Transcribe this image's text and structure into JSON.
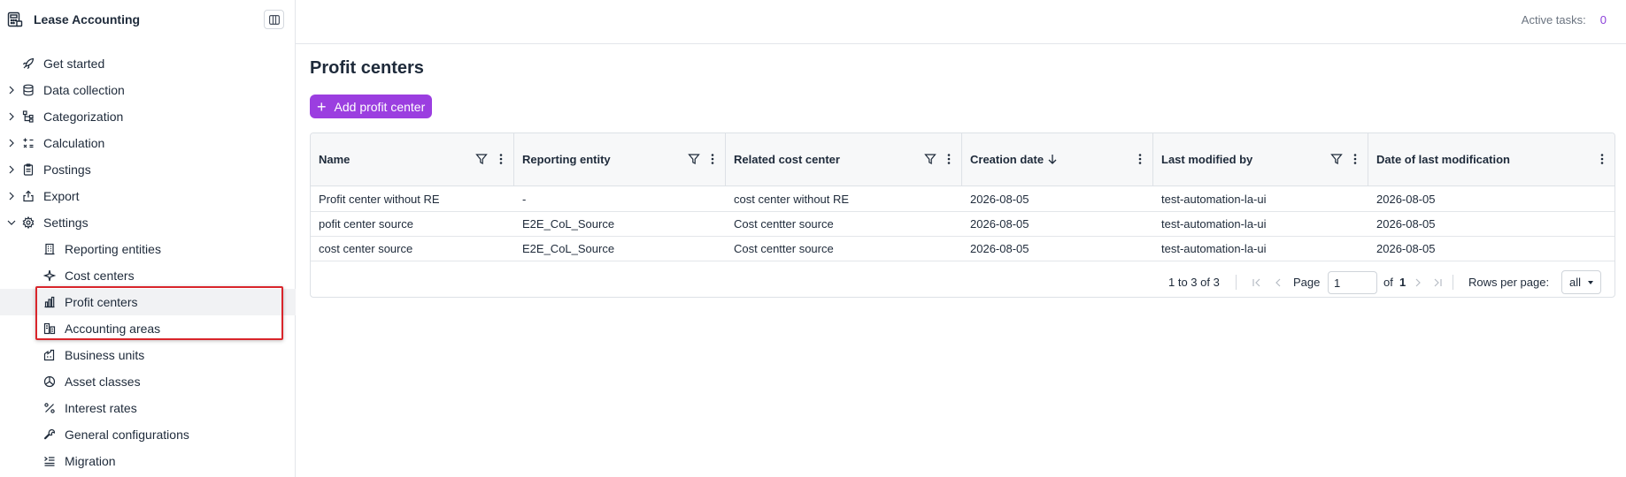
{
  "app": {
    "title": "Lease Accounting"
  },
  "sidebar": {
    "items": [
      {
        "label": "Get started",
        "icon": "rocket-icon",
        "expandable": false
      },
      {
        "label": "Data collection",
        "icon": "database-icon",
        "expandable": true
      },
      {
        "label": "Categorization",
        "icon": "hierarchy-icon",
        "expandable": true
      },
      {
        "label": "Calculation",
        "icon": "calculator-icon",
        "expandable": true
      },
      {
        "label": "Postings",
        "icon": "clipboard-icon",
        "expandable": true
      },
      {
        "label": "Export",
        "icon": "export-icon",
        "expandable": true
      },
      {
        "label": "Settings",
        "icon": "gear-icon",
        "expandable": true,
        "expanded": true
      }
    ],
    "settings_children": [
      {
        "label": "Reporting entities",
        "icon": "building-icon"
      },
      {
        "label": "Cost centers",
        "icon": "sparkle-icon"
      },
      {
        "label": "Profit centers",
        "icon": "bar-chart-icon",
        "active": true
      },
      {
        "label": "Accounting areas",
        "icon": "ledger-icon"
      },
      {
        "label": "Business units",
        "icon": "factory-icon"
      },
      {
        "label": "Asset classes",
        "icon": "pie-icon"
      },
      {
        "label": "Interest rates",
        "icon": "percent-icon"
      },
      {
        "label": "General configurations",
        "icon": "wrench-icon"
      },
      {
        "label": "Migration",
        "icon": "list-indent-icon"
      }
    ]
  },
  "topbar": {
    "active_tasks_label": "Active tasks:",
    "active_tasks_count": "0"
  },
  "main": {
    "title": "Profit centers",
    "add_button_label": "Add profit center",
    "table": {
      "columns": [
        {
          "label": "Name",
          "filter": true,
          "sort": false
        },
        {
          "label": "Reporting entity",
          "filter": true,
          "sort": false
        },
        {
          "label": "Related cost center",
          "filter": true,
          "sort": false
        },
        {
          "label": "Creation date",
          "filter": false,
          "sort": "desc"
        },
        {
          "label": "Last modified by",
          "filter": true,
          "sort": false
        },
        {
          "label": "Date of last modification",
          "filter": false,
          "sort": false
        }
      ],
      "rows": [
        [
          "Profit center without RE",
          "-",
          "cost center without RE",
          "2026-08-05",
          "test-automation-la-ui",
          "2026-08-05"
        ],
        [
          "pofit center source",
          "E2E_CoL_Source",
          "Cost centter source",
          "2026-08-05",
          "test-automation-la-ui",
          "2026-08-05"
        ],
        [
          "cost center source",
          "E2E_CoL_Source",
          "Cost centter source",
          "2026-08-05",
          "test-automation-la-ui",
          "2026-08-05"
        ]
      ]
    },
    "pagination": {
      "range_text": "1 to 3 of 3",
      "page_label": "Page",
      "page_value": "1",
      "of_label": "of",
      "total_pages": "1",
      "rows_per_page_label": "Rows per page:",
      "rows_per_page_value": "all"
    }
  },
  "colors": {
    "accent": "#9b3ee0",
    "highlight": "#d9252b",
    "count": "#8b3fd9"
  }
}
